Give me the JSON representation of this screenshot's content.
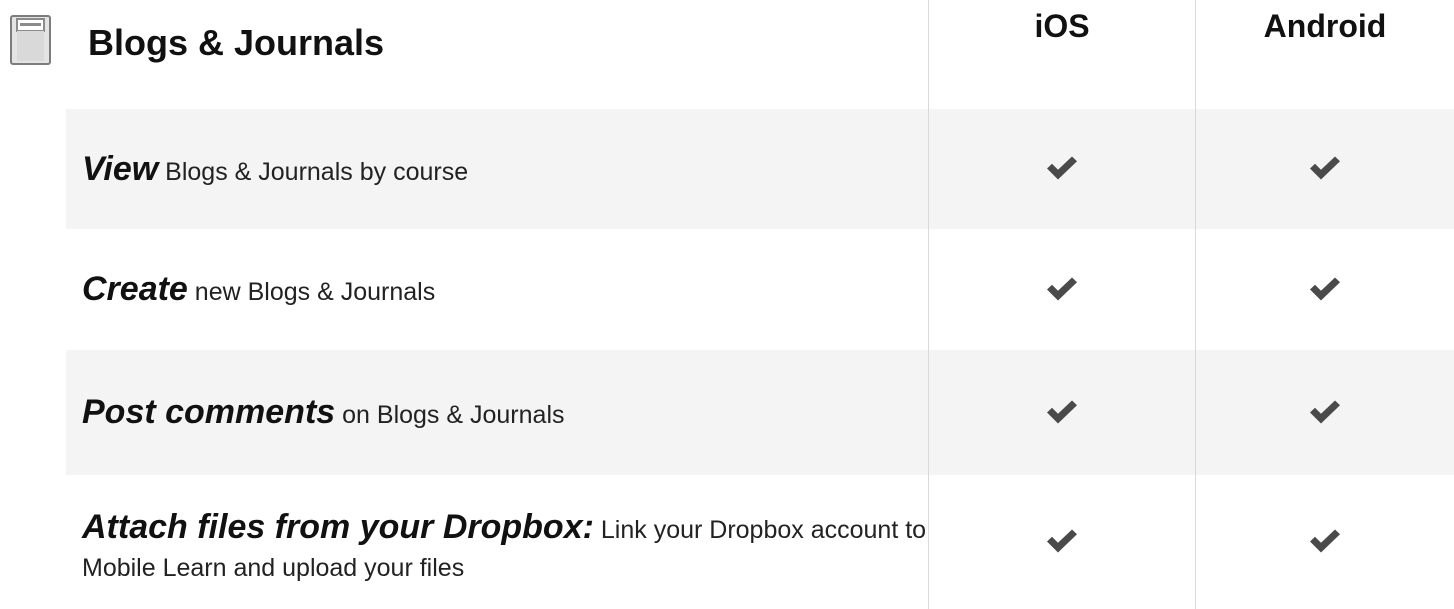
{
  "header": {
    "title": "Blogs & Journals",
    "icon": "notebook-icon"
  },
  "columns": {
    "ios": "iOS",
    "android": "Android"
  },
  "rows": [
    {
      "action": "View",
      "description": "Blogs & Journals by course",
      "ios_supported": true,
      "android_supported": true
    },
    {
      "action": "Create",
      "description": "new Blogs & Journals",
      "ios_supported": true,
      "android_supported": true
    },
    {
      "action": "Post comments",
      "description": "on Blogs & Journals",
      "ios_supported": true,
      "android_supported": true
    },
    {
      "action": "Attach files from your Dropbox:",
      "description": "Link your Dropbox account to Mobile Learn and upload your files",
      "ios_supported": true,
      "android_supported": true
    }
  ],
  "colors": {
    "background": "#ffffff",
    "row_shade": "#f4f4f4",
    "divider": "#d9d9d9",
    "checkmark": "#4a4a4a",
    "text_primary": "#111111"
  }
}
